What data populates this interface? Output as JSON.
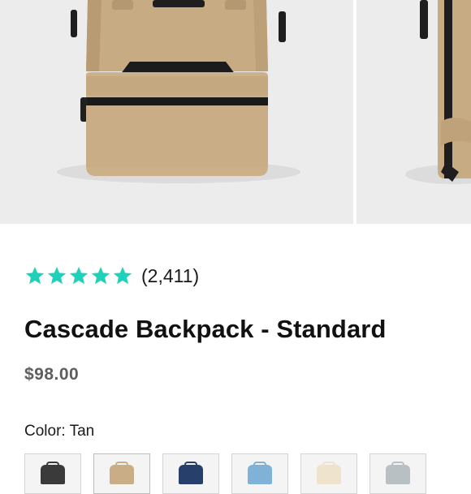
{
  "gallery": {
    "images": [
      {
        "icon": "backpack-front-image",
        "color": "#c9ad86"
      },
      {
        "icon": "backpack-side-image",
        "color": "#c9ad86"
      }
    ]
  },
  "rating": {
    "stars": 5,
    "star_color": "#1fd1b8",
    "count_text": "(2,411)"
  },
  "product": {
    "title": "Cascade Backpack - Standard",
    "price": "$98.00",
    "color_label": "Color: Tan",
    "swatches": [
      {
        "name": "Black",
        "color": "#3a3a3a"
      },
      {
        "name": "Tan",
        "color": "#c9ad86"
      },
      {
        "name": "Navy",
        "color": "#27406b"
      },
      {
        "name": "Sky Blue",
        "color": "#7fb2d6"
      },
      {
        "name": "Cream",
        "color": "#eee3cc"
      },
      {
        "name": "Gray",
        "color": "#b8c0c4"
      }
    ]
  }
}
